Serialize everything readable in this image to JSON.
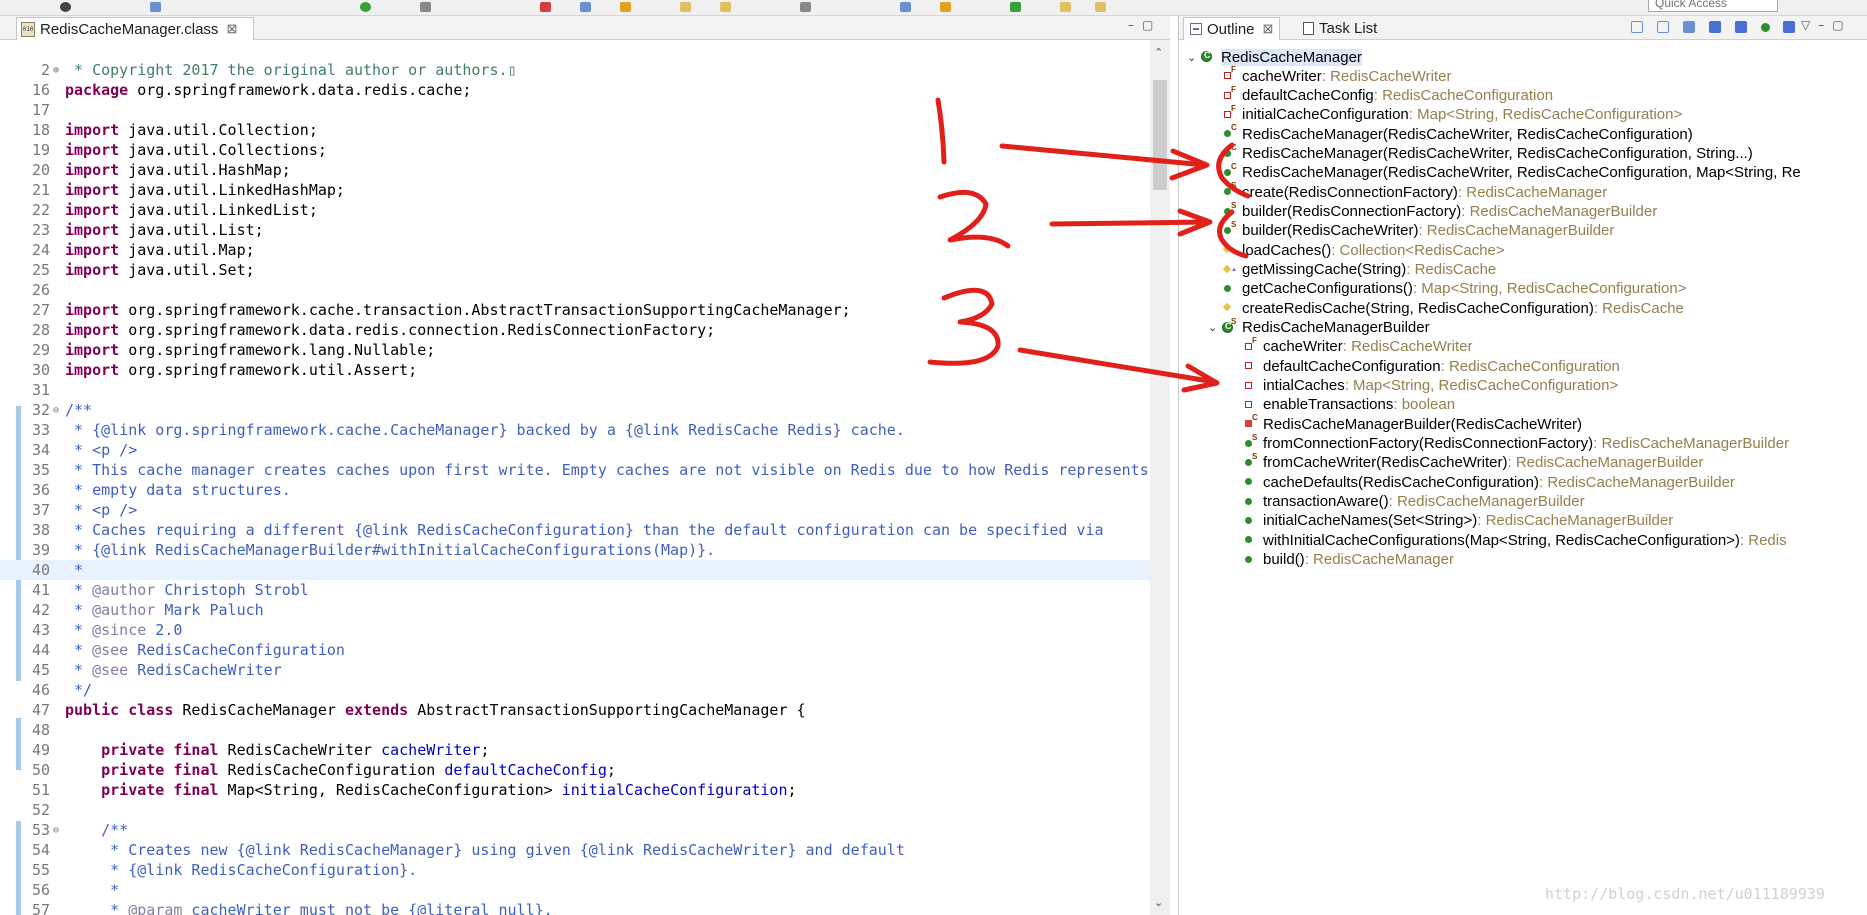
{
  "quick_access_placeholder": "Quick Access",
  "editor": {
    "tab_label": "RedisCacheManager.class",
    "tab_close": "⊠",
    "lines": [
      {
        "n": "2",
        "fold": "⊕",
        "segs": [
          {
            "t": " * Copyright 2017 the original author or authors.▯",
            "c": "cm"
          }
        ]
      },
      {
        "n": "16",
        "segs": [
          {
            "t": "package",
            "c": "kw"
          },
          {
            "t": " org.springframework.data.redis.cache;"
          }
        ]
      },
      {
        "n": "17",
        "segs": []
      },
      {
        "n": "18",
        "segs": [
          {
            "t": "import",
            "c": "kw"
          },
          {
            "t": " java.util.Collection;"
          }
        ]
      },
      {
        "n": "19",
        "segs": [
          {
            "t": "import",
            "c": "kw"
          },
          {
            "t": " java.util.Collections;"
          }
        ]
      },
      {
        "n": "20",
        "segs": [
          {
            "t": "import",
            "c": "kw"
          },
          {
            "t": " java.util.HashMap;"
          }
        ]
      },
      {
        "n": "21",
        "segs": [
          {
            "t": "import",
            "c": "kw"
          },
          {
            "t": " java.util.LinkedHashMap;"
          }
        ]
      },
      {
        "n": "22",
        "segs": [
          {
            "t": "import",
            "c": "kw"
          },
          {
            "t": " java.util.LinkedList;"
          }
        ]
      },
      {
        "n": "23",
        "segs": [
          {
            "t": "import",
            "c": "kw"
          },
          {
            "t": " java.util.List;"
          }
        ]
      },
      {
        "n": "24",
        "segs": [
          {
            "t": "import",
            "c": "kw"
          },
          {
            "t": " java.util.Map;"
          }
        ]
      },
      {
        "n": "25",
        "segs": [
          {
            "t": "import",
            "c": "kw"
          },
          {
            "t": " java.util.Set;"
          }
        ]
      },
      {
        "n": "26",
        "segs": []
      },
      {
        "n": "27",
        "segs": [
          {
            "t": "import",
            "c": "kw"
          },
          {
            "t": " org.springframework.cache.transaction.AbstractTransactionSupportingCacheManager;"
          }
        ]
      },
      {
        "n": "28",
        "segs": [
          {
            "t": "import",
            "c": "kw"
          },
          {
            "t": " org.springframework.data.redis.connection.RedisConnectionFactory;"
          }
        ]
      },
      {
        "n": "29",
        "segs": [
          {
            "t": "import",
            "c": "kw"
          },
          {
            "t": " org.springframework.lang.Nullable;"
          }
        ]
      },
      {
        "n": "30",
        "segs": [
          {
            "t": "import",
            "c": "kw"
          },
          {
            "t": " org.springframework.util.Assert;"
          }
        ]
      },
      {
        "n": "31",
        "segs": []
      },
      {
        "n": "32",
        "fold": "⊖",
        "segs": [
          {
            "t": "/**",
            "c": "jd"
          }
        ]
      },
      {
        "n": "33",
        "segs": [
          {
            "t": " * {@link org.springframework.cache.CacheManager} backed by a {@link RedisCache Redis} cache.",
            "c": "jd"
          }
        ]
      },
      {
        "n": "34",
        "segs": [
          {
            "t": " * <p />",
            "c": "jd"
          }
        ]
      },
      {
        "n": "35",
        "segs": [
          {
            "t": " * This cache manager creates caches upon first write. Empty caches are not visible on Redis due to how Redis represents",
            "c": "jd"
          }
        ]
      },
      {
        "n": "36",
        "segs": [
          {
            "t": " * empty data structures.",
            "c": "jd"
          }
        ]
      },
      {
        "n": "37",
        "segs": [
          {
            "t": " * <p />",
            "c": "jd"
          }
        ]
      },
      {
        "n": "38",
        "segs": [
          {
            "t": " * Caches requiring a different {@link RedisCacheConfiguration} than the default configuration can be specified via",
            "c": "jd"
          }
        ]
      },
      {
        "n": "39",
        "segs": [
          {
            "t": " * {@link RedisCacheManagerBuilder#withInitialCacheConfigurations(Map)}.",
            "c": "jd"
          }
        ]
      },
      {
        "n": "40",
        "current": true,
        "segs": [
          {
            "t": " *",
            "c": "jd"
          }
        ]
      },
      {
        "n": "41",
        "segs": [
          {
            "t": " * ",
            "c": "jd"
          },
          {
            "t": "@author",
            "c": "tag"
          },
          {
            "t": " Christoph Strobl",
            "c": "jd"
          }
        ]
      },
      {
        "n": "42",
        "segs": [
          {
            "t": " * ",
            "c": "jd"
          },
          {
            "t": "@author",
            "c": "tag"
          },
          {
            "t": " Mark Paluch",
            "c": "jd"
          }
        ]
      },
      {
        "n": "43",
        "segs": [
          {
            "t": " * ",
            "c": "jd"
          },
          {
            "t": "@since",
            "c": "tag"
          },
          {
            "t": " 2.0",
            "c": "jd"
          }
        ]
      },
      {
        "n": "44",
        "segs": [
          {
            "t": " * ",
            "c": "jd"
          },
          {
            "t": "@see",
            "c": "tag"
          },
          {
            "t": " RedisCacheConfiguration",
            "c": "jd"
          }
        ]
      },
      {
        "n": "45",
        "segs": [
          {
            "t": " * ",
            "c": "jd"
          },
          {
            "t": "@see",
            "c": "tag"
          },
          {
            "t": " RedisCacheWriter",
            "c": "jd"
          }
        ]
      },
      {
        "n": "46",
        "segs": [
          {
            "t": " */",
            "c": "jd"
          }
        ]
      },
      {
        "n": "47",
        "segs": [
          {
            "t": "public",
            "c": "kw"
          },
          {
            "t": " "
          },
          {
            "t": "class",
            "c": "kw"
          },
          {
            "t": " RedisCacheManager "
          },
          {
            "t": "extends",
            "c": "kw"
          },
          {
            "t": " AbstractTransactionSupportingCacheManager {"
          }
        ]
      },
      {
        "n": "48",
        "segs": []
      },
      {
        "n": "49",
        "segs": [
          {
            "t": "    "
          },
          {
            "t": "private",
            "c": "kw"
          },
          {
            "t": " "
          },
          {
            "t": "final",
            "c": "kw"
          },
          {
            "t": " RedisCacheWriter "
          },
          {
            "t": "cacheWriter",
            "c": "fld"
          },
          {
            "t": ";"
          }
        ]
      },
      {
        "n": "50",
        "segs": [
          {
            "t": "    "
          },
          {
            "t": "private",
            "c": "kw"
          },
          {
            "t": " "
          },
          {
            "t": "final",
            "c": "kw"
          },
          {
            "t": " RedisCacheConfiguration "
          },
          {
            "t": "defaultCacheConfig",
            "c": "fld"
          },
          {
            "t": ";"
          }
        ]
      },
      {
        "n": "51",
        "segs": [
          {
            "t": "    "
          },
          {
            "t": "private",
            "c": "kw"
          },
          {
            "t": " "
          },
          {
            "t": "final",
            "c": "kw"
          },
          {
            "t": " Map<String, RedisCacheConfiguration> "
          },
          {
            "t": "initialCacheConfiguration",
            "c": "fld"
          },
          {
            "t": ";"
          }
        ]
      },
      {
        "n": "52",
        "segs": []
      },
      {
        "n": "53",
        "fold": "⊖",
        "segs": [
          {
            "t": "    "
          },
          {
            "t": "/**",
            "c": "jd"
          }
        ]
      },
      {
        "n": "54",
        "segs": [
          {
            "t": "     * Creates new {@link RedisCacheManager} using given {@link RedisCacheWriter} and default",
            "c": "jd"
          }
        ]
      },
      {
        "n": "55",
        "segs": [
          {
            "t": "     * {@link RedisCacheConfiguration}.",
            "c": "jd"
          }
        ]
      },
      {
        "n": "56",
        "segs": [
          {
            "t": "     *",
            "c": "jd"
          }
        ]
      },
      {
        "n": "57",
        "segs": [
          {
            "t": "     * ",
            "c": "jd"
          },
          {
            "t": "@param",
            "c": "tag"
          },
          {
            "t": " cacheWriter must not be {@literal null}.",
            "c": "jd"
          }
        ]
      }
    ]
  },
  "outline": {
    "tab_outline": "Outline",
    "tab_outline_close": "⊠",
    "tab_tasklist": "Task List",
    "nodes": [
      {
        "depth": 0,
        "expander": "open",
        "icon": "class",
        "label": "RedisCacheManager",
        "selected": true
      },
      {
        "depth": 1,
        "icon": "private",
        "sup": "F",
        "label": "cacheWriter",
        "type": " : RedisCacheWriter"
      },
      {
        "depth": 1,
        "icon": "private",
        "sup": "F",
        "label": "defaultCacheConfig",
        "type": " : RedisCacheConfiguration"
      },
      {
        "depth": 1,
        "icon": "private",
        "sup": "F",
        "label": "initialCacheConfiguration",
        "type": " : Map<String, RedisCacheConfiguration>"
      },
      {
        "depth": 1,
        "icon": "public",
        "sup": "C",
        "label": "RedisCacheManager(RedisCacheWriter, RedisCacheConfiguration)",
        "type": ""
      },
      {
        "depth": 1,
        "icon": "public",
        "sup": "C",
        "label": "RedisCacheManager(RedisCacheWriter, RedisCacheConfiguration, String...)",
        "type": ""
      },
      {
        "depth": 1,
        "icon": "public",
        "sup": "C",
        "label": "RedisCacheManager(RedisCacheWriter, RedisCacheConfiguration, Map<String, Re",
        "type": ""
      },
      {
        "depth": 1,
        "icon": "public",
        "sup": "S",
        "label": "create(RedisConnectionFactory)",
        "type": " : RedisCacheManager"
      },
      {
        "depth": 1,
        "icon": "public",
        "sup": "S",
        "label": "builder(RedisConnectionFactory)",
        "type": " : RedisCacheManagerBuilder"
      },
      {
        "depth": 1,
        "icon": "public",
        "sup": "S",
        "label": "builder(RedisCacheWriter)",
        "type": " : RedisCacheManagerBuilder"
      },
      {
        "depth": 1,
        "icon": "protected",
        "sup": "▲",
        "label": "loadCaches()",
        "type": " : Collection<RedisCache>"
      },
      {
        "depth": 1,
        "icon": "protected",
        "sup": "▲",
        "label": "getMissingCache(String)",
        "type": " : RedisCache"
      },
      {
        "depth": 1,
        "icon": "public",
        "label": "getCacheConfigurations()",
        "type": " : Map<String, RedisCacheConfiguration>"
      },
      {
        "depth": 1,
        "icon": "protected",
        "label": "createRedisCache(String, RedisCacheConfiguration)",
        "type": " : RedisCache"
      },
      {
        "depth": 1,
        "expander": "open",
        "icon": "class",
        "sup": "S",
        "label": "RedisCacheManagerBuilder",
        "type": ""
      },
      {
        "depth": 2,
        "icon": "private",
        "sup": "F",
        "label": "cacheWriter",
        "type": " : RedisCacheWriter"
      },
      {
        "depth": 2,
        "icon": "private",
        "label": "defaultCacheConfiguration",
        "type": " : RedisCacheConfiguration"
      },
      {
        "depth": 2,
        "icon": "private",
        "label": "intialCaches",
        "type": " : Map<String, RedisCacheConfiguration>"
      },
      {
        "depth": 2,
        "icon": "private",
        "label": "enableTransactions",
        "type": " : boolean"
      },
      {
        "depth": 2,
        "icon": "private-fill",
        "sup": "C",
        "label": "RedisCacheManagerBuilder(RedisCacheWriter)",
        "type": ""
      },
      {
        "depth": 2,
        "icon": "public",
        "sup": "S",
        "label": "fromConnectionFactory(RedisConnectionFactory)",
        "type": " : RedisCacheManagerBuilder"
      },
      {
        "depth": 2,
        "icon": "public",
        "sup": "S",
        "label": "fromCacheWriter(RedisCacheWriter)",
        "type": " : RedisCacheManagerBuilder"
      },
      {
        "depth": 2,
        "icon": "public",
        "label": "cacheDefaults(RedisCacheConfiguration)",
        "type": " : RedisCacheManagerBuilder"
      },
      {
        "depth": 2,
        "icon": "public",
        "label": "transactionAware()",
        "type": " : RedisCacheManagerBuilder"
      },
      {
        "depth": 2,
        "icon": "public",
        "label": "initialCacheNames(Set<String>)",
        "type": " : RedisCacheManagerBuilder"
      },
      {
        "depth": 2,
        "icon": "public",
        "label": "withInitialCacheConfigurations(Map<String, RedisCacheConfiguration>)",
        "type": " : Redis"
      },
      {
        "depth": 2,
        "icon": "public",
        "label": "build()",
        "type": " : RedisCacheManager"
      }
    ]
  },
  "annotations": {
    "color": "#e0201a",
    "labels": [
      "1",
      "2",
      "3"
    ]
  },
  "watermark": "http://blog.csdn.net/u011189939",
  "colors": {
    "keyword": "#7f0055",
    "comment": "#3f7f5f",
    "javadoc": "#3f5fbf",
    "field": "#0000c0",
    "return_type": "#947f4f"
  }
}
